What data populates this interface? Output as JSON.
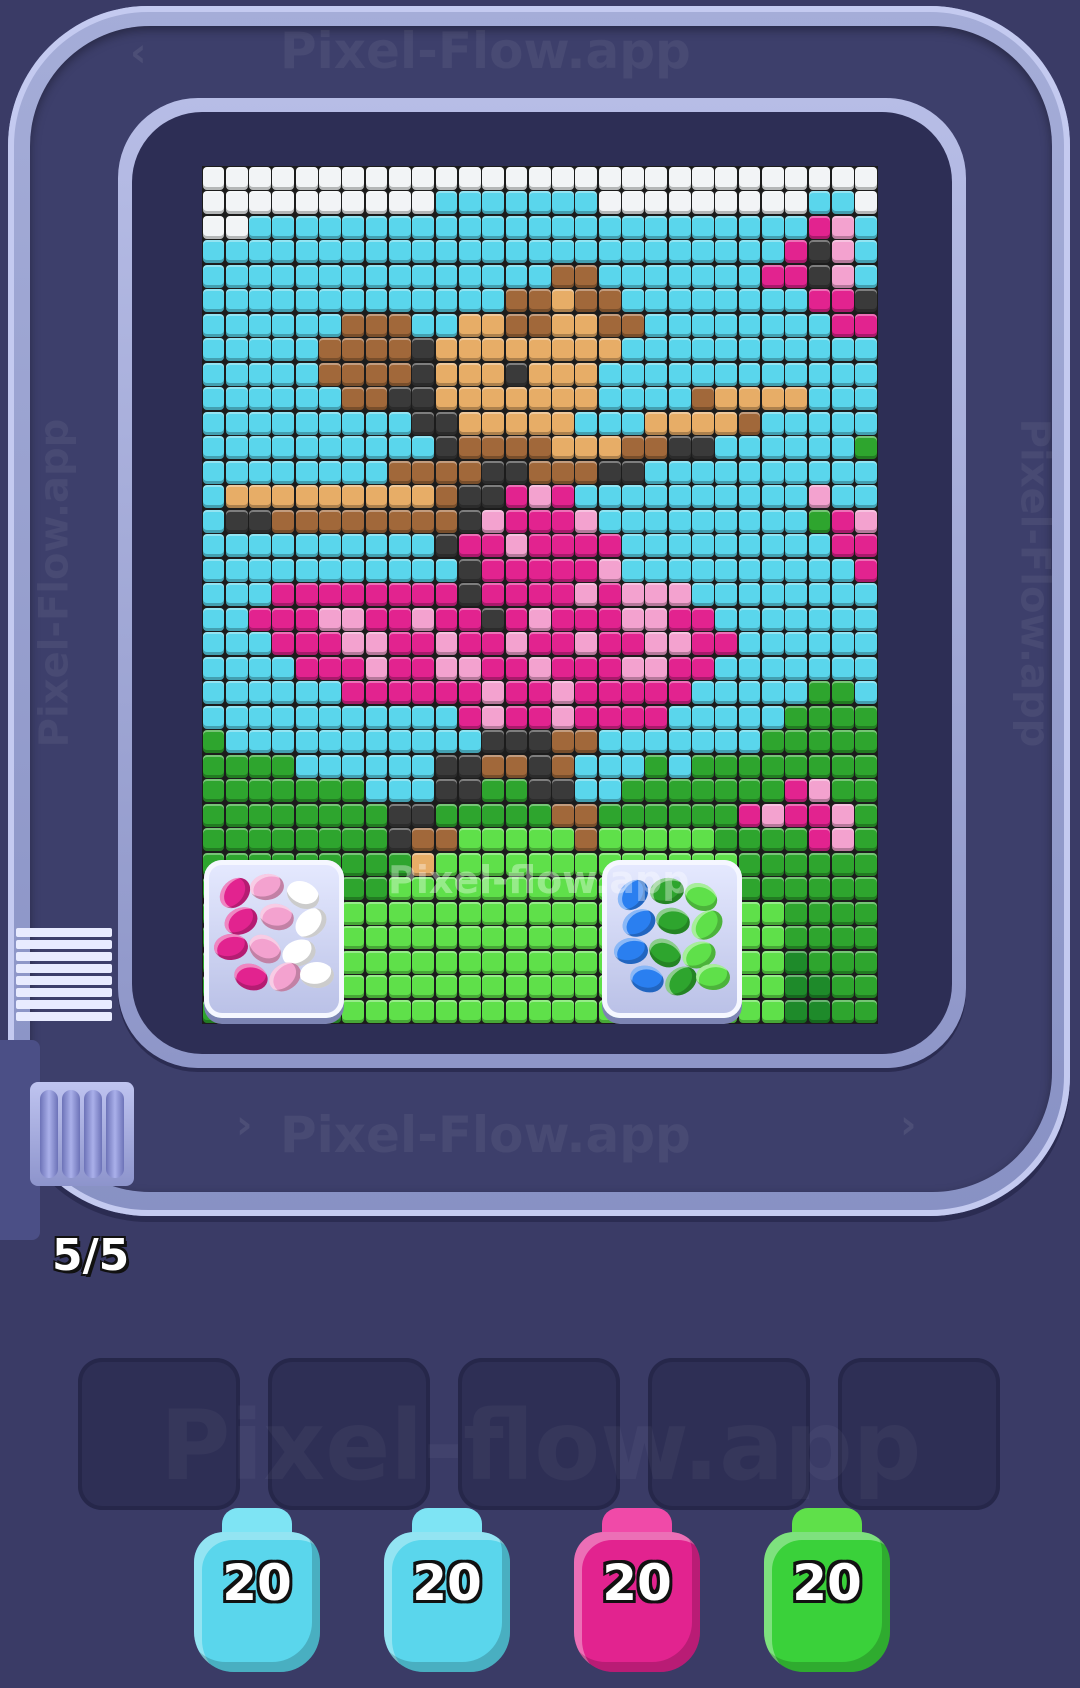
{
  "watermark": {
    "text_top": "Pixel-Flow.app",
    "text_bottom": "Pixel-Flow.app",
    "text_center": "Pixel-flow.app",
    "text_side": "Pixel-Flow.app",
    "text_slots": "Pixel-flow.app"
  },
  "queue_counter": "5/5",
  "palette": {
    "W": "#f2f4f6",
    "S": "#5ad6ec",
    "P": "#e2238f",
    "L": "#f3a2cf",
    "B": "#a1683a",
    "T": "#e7ad67",
    "K": "#3a3a3a",
    "G": "#2ea52e",
    "g": "#5fe04a",
    "D": "#1e8a2a"
  },
  "pixel_grid": [
    "WWWWWWWWWWWWWWWWWWWWWWWWWWWWW",
    "WWWWWWWWWWSSSSSSSWWWWWWWWWSSW",
    "WWSSSSSSSSSSSSSSSSSSSSSSSSPLSW",
    "SSSSSSSSSSSSSSSSSSSSSSSSSPKLSS",
    "SSSSSSSSSSSSSSSBBSSSSSSSPPKLSS",
    "SSSSSSSSSSSSSBBTBBSSSSSSSSPPKS",
    "SSSSSSBBBSSTTBBTTBBSSSSSSSSPPL",
    "SSSSSBBBBKTTTTTTTTSSSSSSSSSSSS",
    "SSSSSBBBBKTTTKTTTSSSSSSSSSSSS",
    "SSSSSSBBKKTTTTTTTSSSSBTTTTSSS",
    "SSSSSSSSSKKTTTTTSSSTTTTBSSSSS",
    "SSSSSSSSSSKBBBBTTTBBKKSSSSSSG",
    "SSSSSSSSBBBBKKBBBKKSSSSSSSSSS",
    "STTTTTTTTTBKKPLPSSSSSSSSSSLSS",
    "SKKBBBBBBBBKLPPPLSSSSSSSSSGPL",
    "SSSSSSSSSSKPPLPPPPSSSSSSSSSPP",
    "SSSSSSSSSSSKPPPPPLSSSSSSSSSSP",
    "SSSPPPPPPPPKPPPPLPLLLSSSSSSSS",
    "SSPPPLLPPLPPKPLPPPLLPPSSSSSSS",
    "SSSPPPLLPPLPPLPPLPPLLPPSSSSSS",
    "SSSSPPPLPPLLPPLPPPLLPPSSSSSSS",
    "SSSSSSPPPPPPLPPLPPPPPSSSSSGGS",
    "SSSSSSSSSSSPLPPLPPPPSSSSSGGGG",
    "GSSSSSSSSSSSKKKBBSSSSSSSGGGGG",
    "GGGGSSSSSSKKBBKBSSSGSGGGGGGGG",
    "GGGGGGGSSSKKGGKKSSGGGGGGGPLGG",
    "GGGGGGGGKKGGGGGBBGGGGGGPLPPLG",
    "GGGGGGGGKBBgggggBgggggGGGGPLG",
    "GGGGGGGGGTgggggggggggggGGGGGG",
    "GGGGGGGGgggggggggggggggGGGGGG",
    "GGGGGGgggggggggggggggggggGGGG",
    "GGGGGGgggggggggggggggggggGGGG",
    "GGGGGGgggggggggggggggggggDGGG",
    "GGGGGGgggggggggggggggggggDDGG",
    "GGGGGGgggggggggggggggggggDDGG"
  ],
  "bins": [
    {
      "name": "bin-pink",
      "colors": [
        "#e2238f",
        "#f3a2cf",
        "#ffffff"
      ]
    },
    {
      "name": "bin-blue-green",
      "colors": [
        "#2a7ff0",
        "#2ea52e",
        "#5fe04a"
      ]
    }
  ],
  "slots": [
    "",
    "",
    "",
    "",
    ""
  ],
  "shooters": [
    {
      "count": "20",
      "color": "#5ad6ec",
      "head": "#7ee4f4"
    },
    {
      "count": "20",
      "color": "#5ad6ec",
      "head": "#7ee4f4"
    },
    {
      "count": "20",
      "color": "#e2238f",
      "head": "#f04aa8"
    },
    {
      "count": "20",
      "color": "#3ad13a",
      "head": "#5fe04a"
    }
  ]
}
